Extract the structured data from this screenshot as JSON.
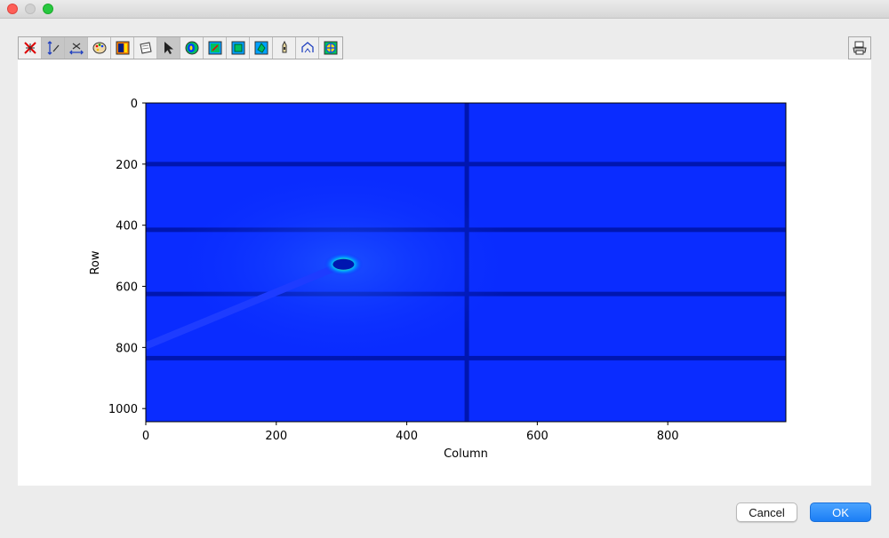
{
  "window": {
    "controls": [
      "close",
      "minimize",
      "maximize"
    ]
  },
  "toolbar": {
    "buttons": [
      {
        "icon": "reset-zoom-icon",
        "active": false
      },
      {
        "icon": "y-autoscale-icon",
        "active": true
      },
      {
        "icon": "x-autoscale-icon",
        "active": true
      },
      {
        "icon": "colormap-palette-icon",
        "active": false
      },
      {
        "icon": "colorbar-icon",
        "active": false
      },
      {
        "icon": "save-icon",
        "active": false
      },
      {
        "icon": "select-pointer-icon",
        "active": true
      },
      {
        "icon": "mask-tool-icon",
        "active": false
      },
      {
        "icon": "mask-sector-icon",
        "active": false
      },
      {
        "icon": "mask-rectangle-icon",
        "active": false
      },
      {
        "icon": "mask-polygon-icon",
        "active": false
      },
      {
        "icon": "beam-stop-icon",
        "active": false
      },
      {
        "icon": "peak-icon",
        "active": false
      },
      {
        "icon": "center-crosshair-icon",
        "active": false
      }
    ],
    "print_icon": "print-icon"
  },
  "chart_data": {
    "type": "heatmap",
    "xlabel": "Column",
    "ylabel": "Row",
    "xlim": [
      0,
      981
    ],
    "ylim": [
      1043,
      0
    ],
    "xticks": [
      0,
      200,
      400,
      600,
      800
    ],
    "yticks": [
      0,
      200,
      400,
      600,
      800,
      1000
    ],
    "colormap": "jet",
    "colors": {
      "background": "#0a2cff",
      "gap": "#0016b0",
      "beamstop": "#1e3cff"
    },
    "module_gaps": {
      "horizontal_rows": [
        200,
        415,
        625,
        835
      ],
      "vertical_columns": [
        492
      ]
    },
    "beam_center": {
      "column": 303,
      "row": 528
    },
    "beamstop_arm": {
      "from": [
        303,
        528
      ],
      "to": [
        0,
        795
      ]
    }
  },
  "buttons": {
    "cancel": "Cancel",
    "ok": "OK"
  }
}
